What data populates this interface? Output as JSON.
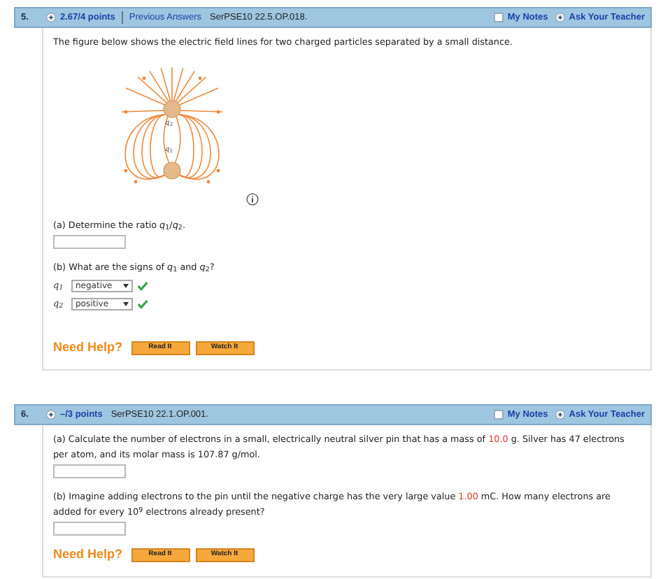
{
  "questions": [
    {
      "number": "5.",
      "points": "2.67/4 points",
      "previous_answers": "Previous Answers",
      "code": "SerPSE10 22.5.OP.018.",
      "my_notes": "My Notes",
      "notes_checked": false,
      "ask_teacher": "Ask Your Teacher",
      "intro": [
        {
          "text": "The figure below shows the electric field lines for two charged particles separated by a small distance.",
          "highlight": false
        }
      ],
      "figure": {
        "labels": [
          "*q*$_{2}$",
          "*q*$_{1}$"
        ]
      },
      "parts": [
        {
          "kind": "input",
          "prompt": [
            {
              "text": "(a) Determine the ratio *q*$_{1}$/*q*$_{2}$.",
              "highlight": false
            }
          ]
        },
        {
          "kind": "selects",
          "prompt": [
            {
              "text": "(b) What are the signs of *q*$_{1}$ and *q*$_{2}$?",
              "highlight": false
            }
          ],
          "rows": [
            {
              "label": "*q*$_{1}$",
              "value": "negative",
              "correct": true
            },
            {
              "label": "*q*$_{2}$",
              "value": "positive",
              "correct": true
            }
          ]
        }
      ],
      "help_label": "Need Help?",
      "help_buttons": [
        "Read It",
        "Watch It"
      ]
    },
    {
      "number": "6.",
      "points": "–/3 points",
      "code": "SerPSE10 22.1.OP.001.",
      "my_notes": "My Notes",
      "notes_checked": false,
      "ask_teacher": "Ask Your Teacher",
      "parts": [
        {
          "kind": "input",
          "prompt": [
            {
              "text": "(a) Calculate the number of electrons in a small, electrically neutral silver pin that has a mass of ",
              "highlight": false
            },
            {
              "text": "10.0",
              "highlight": true
            },
            {
              "text": " g. Silver has 47 electrons per atom, and its molar mass is 107.87 g/mol.",
              "highlight": false
            }
          ]
        },
        {
          "kind": "input",
          "prompt": [
            {
              "text": "(b) Imagine adding electrons to the pin until the negative charge has the very large value ",
              "highlight": false
            },
            {
              "text": "1.00",
              "highlight": true
            },
            {
              "text": " mC. How many electrons are added for every 10$^{9}$ electrons already present?",
              "highlight": false
            }
          ]
        }
      ],
      "help_label": "Need Help?",
      "help_buttons": [
        "Read It",
        "Watch It"
      ]
    }
  ]
}
